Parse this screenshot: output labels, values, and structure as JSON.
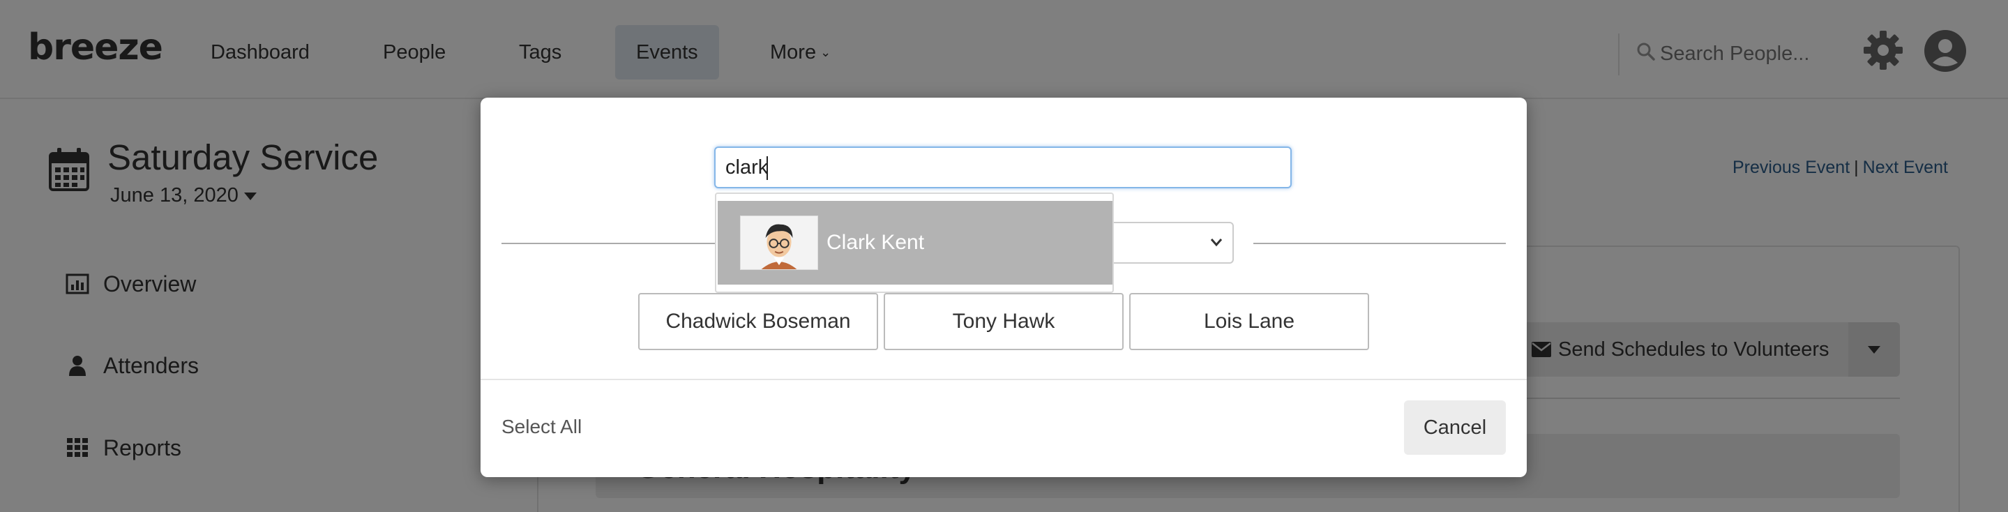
{
  "app": {
    "logo": "breeze"
  },
  "nav": {
    "items": [
      {
        "label": "Dashboard"
      },
      {
        "label": "People"
      },
      {
        "label": "Tags"
      },
      {
        "label": "Events"
      },
      {
        "label": "More"
      }
    ],
    "active": "Events",
    "search_placeholder": "Search People..."
  },
  "event": {
    "title": "Saturday Service",
    "date": "June 13, 2020",
    "prev_label": "Previous Event",
    "separator": "|",
    "next_label": "Next Event"
  },
  "sidebar": {
    "items": [
      {
        "label": "Overview",
        "icon": "bar-chart-icon"
      },
      {
        "label": "Attenders",
        "icon": "person-icon"
      },
      {
        "label": "Reports",
        "icon": "grid-icon"
      }
    ]
  },
  "panel": {
    "send_label": "Send Schedules to Volunteers",
    "team_label": "General Hospitality"
  },
  "modal": {
    "search_value": "clark",
    "suggestion": {
      "name": "Clark Kent"
    },
    "people": [
      "Chadwick Boseman",
      "Tony Hawk",
      "Lois Lane"
    ],
    "select_all_label": "Select All",
    "cancel_label": "Cancel"
  },
  "colors": {
    "overlay": "#000000",
    "focus_border": "#84b6e8",
    "link": "#2b5c8a",
    "active_nav": "#dfe6ee",
    "suggestion_highlight": "#b3b3b3"
  }
}
